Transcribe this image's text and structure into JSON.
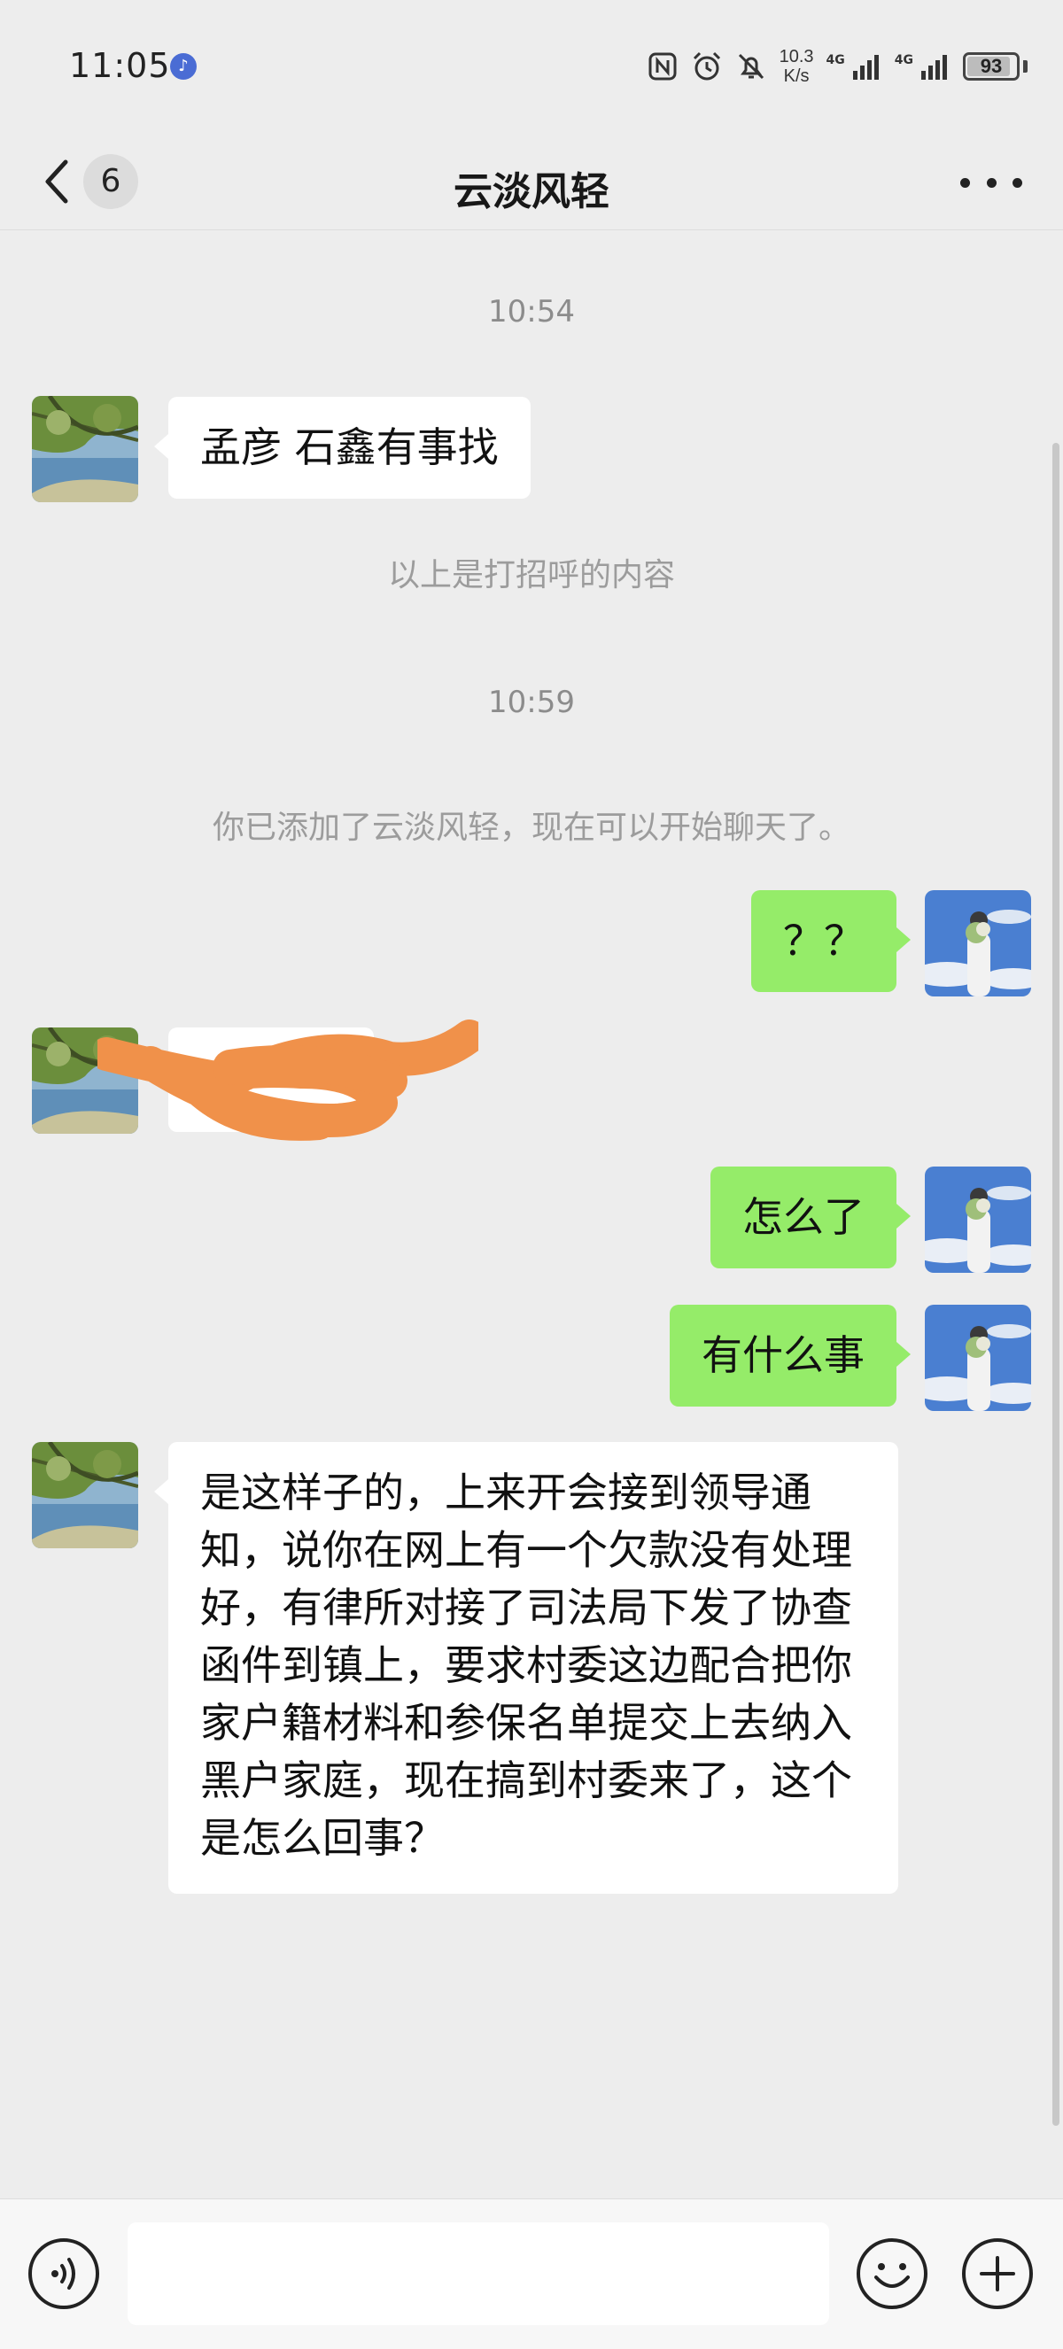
{
  "status_bar": {
    "time": "11:05",
    "net_speed_value": "10.3",
    "net_speed_unit": "K/s",
    "signal_1": "4G",
    "signal_2": "4G",
    "battery": "93",
    "battery_level": 0.93,
    "icons": [
      "music-icon",
      "nfc-icon",
      "alarm-icon",
      "mute-icon",
      "signal-icon",
      "battery-icon"
    ]
  },
  "header": {
    "unread_count": "6",
    "title": "云淡风轻"
  },
  "messages": {
    "time_1": "10:54",
    "greeting": "孟彦 石鑫有事找",
    "greeting_note": "以上是打招呼的内容",
    "time_2": "10:59",
    "added_note": "你已添加了云淡风轻，现在可以开始聊天了。",
    "me_1": "？？",
    "me_2": "怎么了",
    "me_3": "有什么事",
    "them_long": "是这样子的，上来开会接到领导通知，说你在网上有一个欠款没有处理好，有律所对接了司法局下发了协查函件到镇上，要求村委这边配合把你家户籍材料和参保名单提交上去纳入黑户家庭，现在搞到村委来了，这个是怎么回事？"
  },
  "colors": {
    "background": "#ededed",
    "my_bubble": "#95ec69",
    "their_bubble": "#ffffff",
    "scribble": "#f0914a"
  },
  "input": {
    "value": "",
    "placeholder": ""
  }
}
